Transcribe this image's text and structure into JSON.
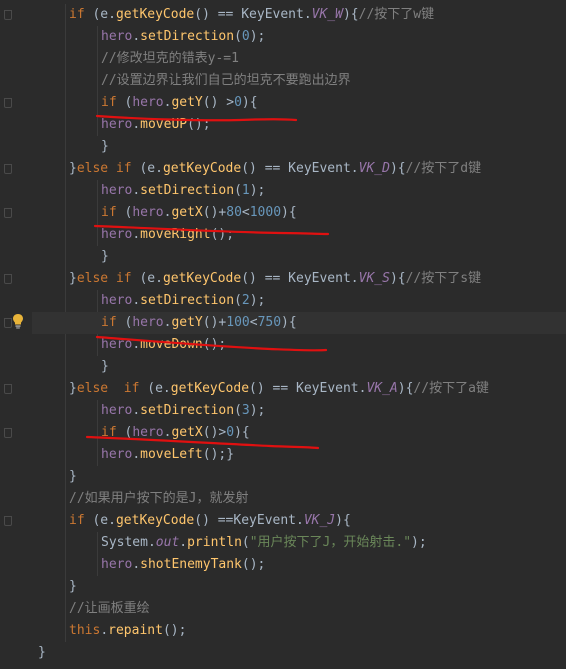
{
  "lines": [
    {
      "i": 0,
      "indent": 2,
      "tokens": [
        [
          "kw",
          "if"
        ],
        [
          "p",
          " (e."
        ],
        [
          "meth",
          "getKeyCode"
        ],
        [
          "p",
          "() == KeyEvent."
        ],
        [
          "const",
          "VK_W"
        ],
        [
          "p",
          "){"
        ],
        [
          "cmt",
          "//按下了w键"
        ]
      ]
    },
    {
      "i": 1,
      "indent": 3,
      "tokens": [
        [
          "fld",
          "hero"
        ],
        [
          "p",
          "."
        ],
        [
          "meth",
          "setDirection"
        ],
        [
          "p",
          "("
        ],
        [
          "num",
          "0"
        ],
        [
          "p",
          ");"
        ]
      ]
    },
    {
      "i": 2,
      "indent": 3,
      "tokens": [
        [
          "cmt",
          "//修改坦克的错表y-=1"
        ]
      ]
    },
    {
      "i": 3,
      "indent": 3,
      "tokens": [
        [
          "cmt",
          "//设置边界让我们自己的坦克不要跑出边界"
        ]
      ]
    },
    {
      "i": 4,
      "indent": 3,
      "tokens": [
        [
          "kw",
          "if"
        ],
        [
          "p",
          " ("
        ],
        [
          "fld",
          "hero"
        ],
        [
          "p",
          "."
        ],
        [
          "meth",
          "getY"
        ],
        [
          "p",
          "() >"
        ],
        [
          "num",
          "0"
        ],
        [
          "p",
          "){"
        ]
      ]
    },
    {
      "i": 5,
      "indent": 3,
      "tokens": [
        [
          "fld",
          "hero"
        ],
        [
          "p",
          "."
        ],
        [
          "meth",
          "moveUP"
        ],
        [
          "p",
          "();"
        ]
      ]
    },
    {
      "i": 6,
      "indent": 3,
      "tokens": [
        [
          "p",
          "}"
        ]
      ]
    },
    {
      "i": 7,
      "indent": 2,
      "tokens": [
        [
          "p",
          "}"
        ],
        [
          "kw",
          "else if"
        ],
        [
          "p",
          " (e."
        ],
        [
          "meth",
          "getKeyCode"
        ],
        [
          "p",
          "() == KeyEvent."
        ],
        [
          "const",
          "VK_D"
        ],
        [
          "p",
          "){"
        ],
        [
          "cmt",
          "//按下了d键"
        ]
      ]
    },
    {
      "i": 8,
      "indent": 3,
      "tokens": [
        [
          "fld",
          "hero"
        ],
        [
          "p",
          "."
        ],
        [
          "meth",
          "setDirection"
        ],
        [
          "p",
          "("
        ],
        [
          "num",
          "1"
        ],
        [
          "p",
          ");"
        ]
      ]
    },
    {
      "i": 9,
      "indent": 3,
      "tokens": [
        [
          "kw",
          "if"
        ],
        [
          "p",
          " ("
        ],
        [
          "fld",
          "hero"
        ],
        [
          "p",
          "."
        ],
        [
          "meth",
          "getX"
        ],
        [
          "p",
          "()+"
        ],
        [
          "num",
          "80"
        ],
        [
          "p",
          "<"
        ],
        [
          "num",
          "1000"
        ],
        [
          "p",
          "){"
        ]
      ]
    },
    {
      "i": 10,
      "indent": 3,
      "tokens": [
        [
          "fld",
          "hero"
        ],
        [
          "p",
          "."
        ],
        [
          "meth",
          "moveRight"
        ],
        [
          "p",
          "();"
        ]
      ]
    },
    {
      "i": 11,
      "indent": 3,
      "tokens": [
        [
          "p",
          "}"
        ]
      ]
    },
    {
      "i": 12,
      "indent": 2,
      "tokens": [
        [
          "p",
          "}"
        ],
        [
          "kw",
          "else if"
        ],
        [
          "p",
          " (e."
        ],
        [
          "meth",
          "getKeyCode"
        ],
        [
          "p",
          "() == KeyEvent."
        ],
        [
          "const",
          "VK_S"
        ],
        [
          "p",
          "){"
        ],
        [
          "cmt",
          "//按下了s键"
        ]
      ]
    },
    {
      "i": 13,
      "indent": 3,
      "tokens": [
        [
          "fld",
          "hero"
        ],
        [
          "p",
          "."
        ],
        [
          "meth",
          "setDirection"
        ],
        [
          "p",
          "("
        ],
        [
          "num",
          "2"
        ],
        [
          "p",
          ");"
        ]
      ]
    },
    {
      "i": 14,
      "indent": 3,
      "current": true,
      "tokens": [
        [
          "kw",
          "if"
        ],
        [
          "p",
          " ("
        ],
        [
          "fld",
          "hero"
        ],
        [
          "p",
          "."
        ],
        [
          "meth",
          "getY"
        ],
        [
          "p",
          "()+"
        ],
        [
          "num",
          "100"
        ],
        [
          "p",
          "<"
        ],
        [
          "num",
          "750"
        ],
        [
          "p",
          "){"
        ]
      ]
    },
    {
      "i": 15,
      "indent": 3,
      "tokens": [
        [
          "fld",
          "hero"
        ],
        [
          "p",
          "."
        ],
        [
          "meth",
          "moveDown"
        ],
        [
          "p",
          "();"
        ]
      ]
    },
    {
      "i": 16,
      "indent": 3,
      "tokens": [
        [
          "p",
          "}"
        ]
      ]
    },
    {
      "i": 17,
      "indent": 2,
      "tokens": [
        [
          "p",
          "}"
        ],
        [
          "kw",
          "else  if"
        ],
        [
          "p",
          " (e."
        ],
        [
          "meth",
          "getKeyCode"
        ],
        [
          "p",
          "() == KeyEvent."
        ],
        [
          "const",
          "VK_A"
        ],
        [
          "p",
          "){"
        ],
        [
          "cmt",
          "//按下了a键"
        ]
      ]
    },
    {
      "i": 18,
      "indent": 3,
      "tokens": [
        [
          "fld",
          "hero"
        ],
        [
          "p",
          "."
        ],
        [
          "meth",
          "setDirection"
        ],
        [
          "p",
          "("
        ],
        [
          "num",
          "3"
        ],
        [
          "p",
          ");"
        ]
      ]
    },
    {
      "i": 19,
      "indent": 3,
      "tokens": [
        [
          "kw",
          "if"
        ],
        [
          "p",
          " ("
        ],
        [
          "fld",
          "hero"
        ],
        [
          "p",
          "."
        ],
        [
          "meth",
          "getX"
        ],
        [
          "p",
          "()>"
        ],
        [
          "num",
          "0"
        ],
        [
          "p",
          "){"
        ]
      ]
    },
    {
      "i": 20,
      "indent": 3,
      "tokens": [
        [
          "fld",
          "hero"
        ],
        [
          "p",
          "."
        ],
        [
          "meth",
          "moveLeft"
        ],
        [
          "p",
          "();}"
        ]
      ]
    },
    {
      "i": 21,
      "indent": 2,
      "tokens": [
        [
          "p",
          "}"
        ]
      ]
    },
    {
      "i": 22,
      "indent": 2,
      "tokens": [
        [
          "cmt",
          "//如果用户按下的是J，就发射"
        ]
      ]
    },
    {
      "i": 23,
      "indent": 2,
      "tokens": [
        [
          "kw",
          "if"
        ],
        [
          "p",
          " (e."
        ],
        [
          "meth",
          "getKeyCode"
        ],
        [
          "p",
          "() ==KeyEvent."
        ],
        [
          "const",
          "VK_J"
        ],
        [
          "p",
          "){"
        ]
      ]
    },
    {
      "i": 24,
      "indent": 3,
      "tokens": [
        [
          "p",
          "System."
        ],
        [
          "static",
          "out"
        ],
        [
          "p",
          "."
        ],
        [
          "meth",
          "println"
        ],
        [
          "p",
          "("
        ],
        [
          "str",
          "\"用户按下了J，开始射击.\""
        ],
        [
          "p",
          ");"
        ]
      ]
    },
    {
      "i": 25,
      "indent": 3,
      "tokens": [
        [
          "fld",
          "hero"
        ],
        [
          "p",
          "."
        ],
        [
          "meth",
          "shotEnemyTank"
        ],
        [
          "p",
          "();"
        ]
      ]
    },
    {
      "i": 26,
      "indent": 2,
      "tokens": [
        [
          "p",
          "}"
        ]
      ]
    },
    {
      "i": 27,
      "indent": 2,
      "tokens": [
        [
          "cmt",
          "//让画板重绘"
        ]
      ]
    },
    {
      "i": 28,
      "indent": 2,
      "tokens": [
        [
          "kw",
          "this"
        ],
        [
          "p",
          "."
        ],
        [
          "meth",
          "repaint"
        ],
        [
          "p",
          "();"
        ]
      ]
    },
    {
      "i": 29,
      "indent": 0,
      "tokens": [
        [
          "p",
          "}"
        ]
      ]
    }
  ],
  "theme": {
    "background": "#2b2b2b",
    "current_line": "#323232",
    "annotation_color": "#e01010"
  }
}
